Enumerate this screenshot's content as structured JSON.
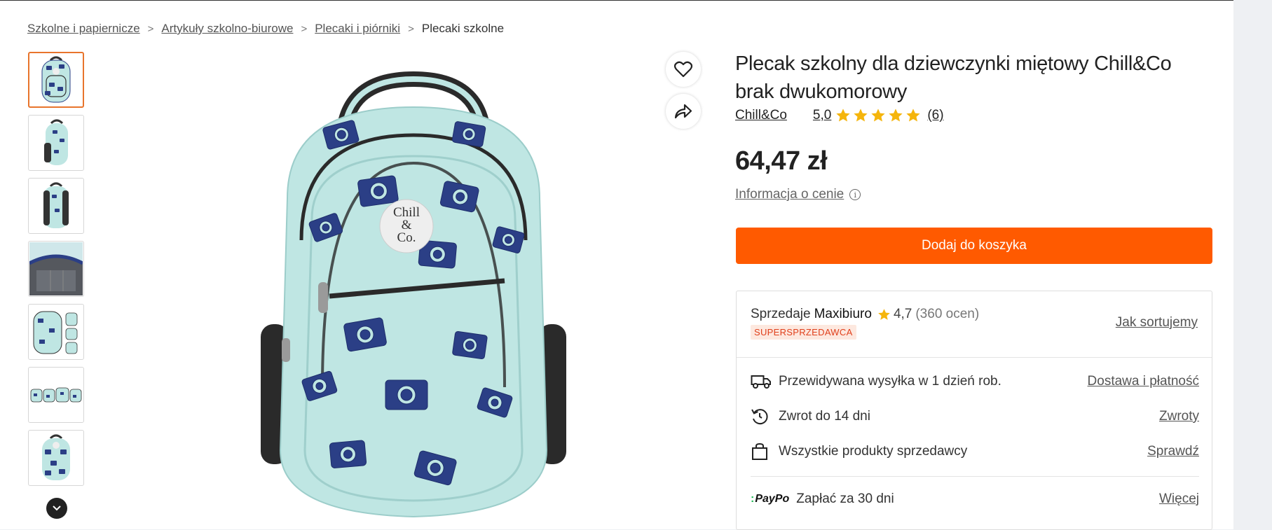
{
  "breadcrumb": {
    "items": [
      "Szkolne i papiernicze",
      "Artykuły szkolno-biurowe",
      "Plecaki i piórniki"
    ],
    "current": "Plecaki szkolne",
    "separator": ">"
  },
  "product": {
    "title": "Plecak szkolny dla dziewczynki miętowy Chill&Co brak dwukomorowy",
    "brand": "Chill&Co",
    "rating": "5,0",
    "stars": 5,
    "review_count": "(6)",
    "price": "64,47 zł",
    "price_info": "Informacja o cenie",
    "add_to_cart": "Dodaj do koszyka",
    "logo_text": "Chill & Co."
  },
  "seller": {
    "prefix": "Sprzedaje",
    "name": "Maxibiuro",
    "rating": "4,7",
    "count": "(360 ocen)",
    "badge": "SUPERSPRZEDAWCA",
    "how_sort": "Jak sortujemy"
  },
  "info_rows": [
    {
      "icon": "truck-icon",
      "text": "Przewidywana wysyłka w 1 dzień rob.",
      "link": "Dostawa i płatność"
    },
    {
      "icon": "return-icon",
      "text": "Zwrot do 14 dni",
      "link": "Zwroty"
    },
    {
      "icon": "bag-icon",
      "text": "Wszystkie produkty sprzedawcy",
      "link": "Sprawdź"
    },
    {
      "icon": "paypo-logo",
      "logo": "PayPo",
      "text": "Zapłać za 30 dni",
      "link": "Więcej"
    }
  ],
  "colors": {
    "accent": "#ff5a00",
    "star": "#f5b50c",
    "badge_text": "#e0401c",
    "backpack": "#bfe6e3",
    "print": "#2b3f86"
  }
}
